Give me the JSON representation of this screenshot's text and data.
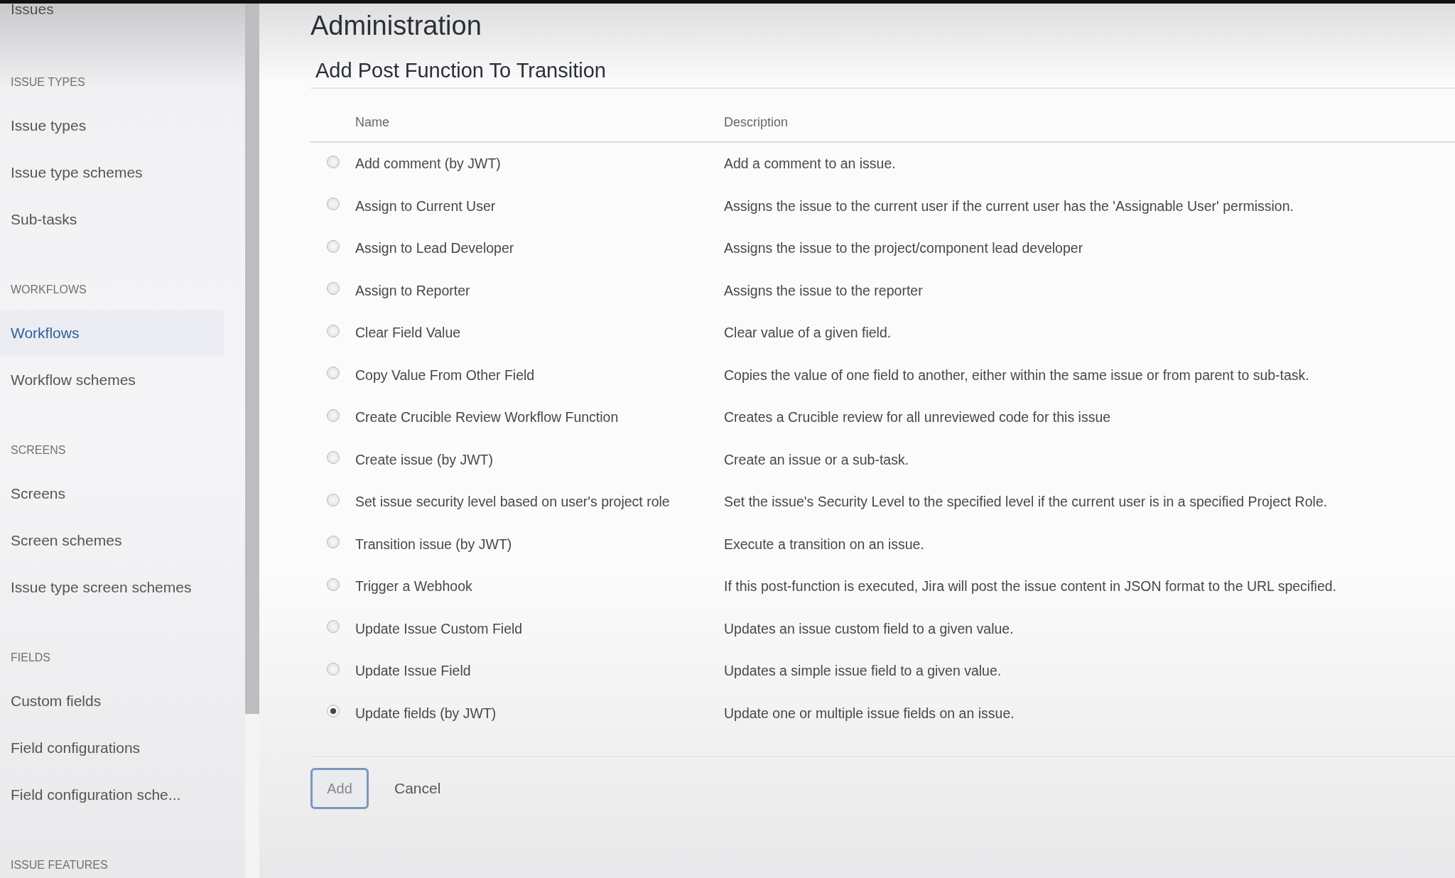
{
  "sidebar": {
    "title": "Issues",
    "sections": [
      {
        "heading": "ISSUE TYPES",
        "items": [
          {
            "label": "Issue types",
            "selected": false
          },
          {
            "label": "Issue type schemes",
            "selected": false
          },
          {
            "label": "Sub-tasks",
            "selected": false
          }
        ]
      },
      {
        "heading": "WORKFLOWS",
        "items": [
          {
            "label": "Workflows",
            "selected": true
          },
          {
            "label": "Workflow schemes",
            "selected": false
          }
        ]
      },
      {
        "heading": "SCREENS",
        "items": [
          {
            "label": "Screens",
            "selected": false
          },
          {
            "label": "Screen schemes",
            "selected": false
          },
          {
            "label": "Issue type screen schemes",
            "selected": false
          }
        ]
      },
      {
        "heading": "FIELDS",
        "items": [
          {
            "label": "Custom fields",
            "selected": false
          },
          {
            "label": "Field configurations",
            "selected": false
          },
          {
            "label": "Field configuration sche...",
            "selected": false
          }
        ]
      },
      {
        "heading": "ISSUE FEATURES"
      }
    ]
  },
  "page": {
    "title": "Administration",
    "subtitle": "Add Post Function To Transition"
  },
  "table": {
    "columns": [
      "Name",
      "Description"
    ],
    "rows": [
      {
        "name": "Add comment (by JWT)",
        "description": "Add a comment to an issue.",
        "selected": false
      },
      {
        "name": "Assign to Current User",
        "description": "Assigns the issue to the current user if the current user has the 'Assignable User' permission.",
        "selected": false
      },
      {
        "name": "Assign to Lead Developer",
        "description": "Assigns the issue to the project/component lead developer",
        "selected": false
      },
      {
        "name": "Assign to Reporter",
        "description": "Assigns the issue to the reporter",
        "selected": false
      },
      {
        "name": "Clear Field Value",
        "description": "Clear value of a given field.",
        "selected": false
      },
      {
        "name": "Copy Value From Other Field",
        "description": "Copies the value of one field to another, either within the same issue or from parent to sub-task.",
        "selected": false
      },
      {
        "name": "Create Crucible Review Workflow Function",
        "description": "Creates a Crucible review for all unreviewed code for this issue",
        "selected": false
      },
      {
        "name": "Create issue (by JWT)",
        "description": "Create an issue or a sub-task.",
        "selected": false
      },
      {
        "name": "Set issue security level based on user's project role",
        "description": "Set the issue's Security Level to the specified level if the current user is in a specified Project Role.",
        "selected": false
      },
      {
        "name": "Transition issue (by JWT)",
        "description": "Execute a transition on an issue.",
        "selected": false
      },
      {
        "name": "Trigger a Webhook",
        "description": "If this post-function is executed, Jira will post the issue content in JSON format to the URL specified.",
        "selected": false
      },
      {
        "name": "Update Issue Custom Field",
        "description": "Updates an issue custom field to a given value.",
        "selected": false
      },
      {
        "name": "Update Issue Field",
        "description": "Updates a simple issue field to a given value.",
        "selected": false
      },
      {
        "name": "Update fields (by JWT)",
        "description": "Update one or multiple issue fields on an issue.",
        "selected": true
      }
    ]
  },
  "buttons": {
    "primary": "Add",
    "cancel": "Cancel"
  }
}
